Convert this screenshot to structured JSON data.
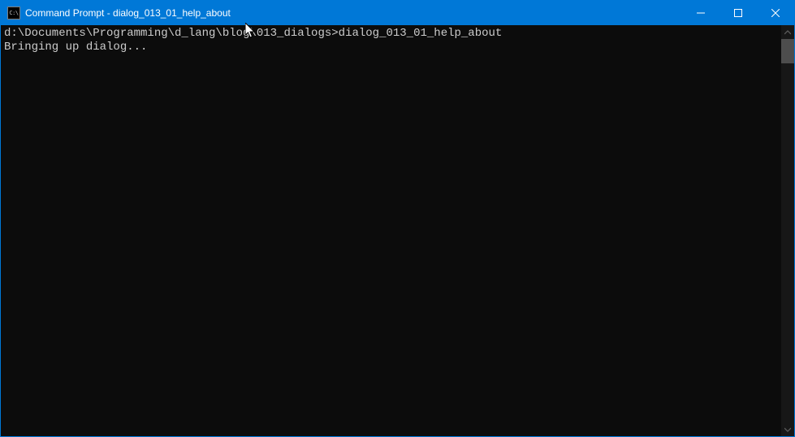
{
  "titlebar": {
    "icon_label": "C:\\",
    "title": "Command Prompt - dialog_013_01_help_about"
  },
  "terminal": {
    "prompt": "d:\\Documents\\Programming\\d_lang\\blog\\013_dialogs>",
    "command": "dialog_013_01_help_about",
    "output_line_1": "Bringing up dialog..."
  }
}
